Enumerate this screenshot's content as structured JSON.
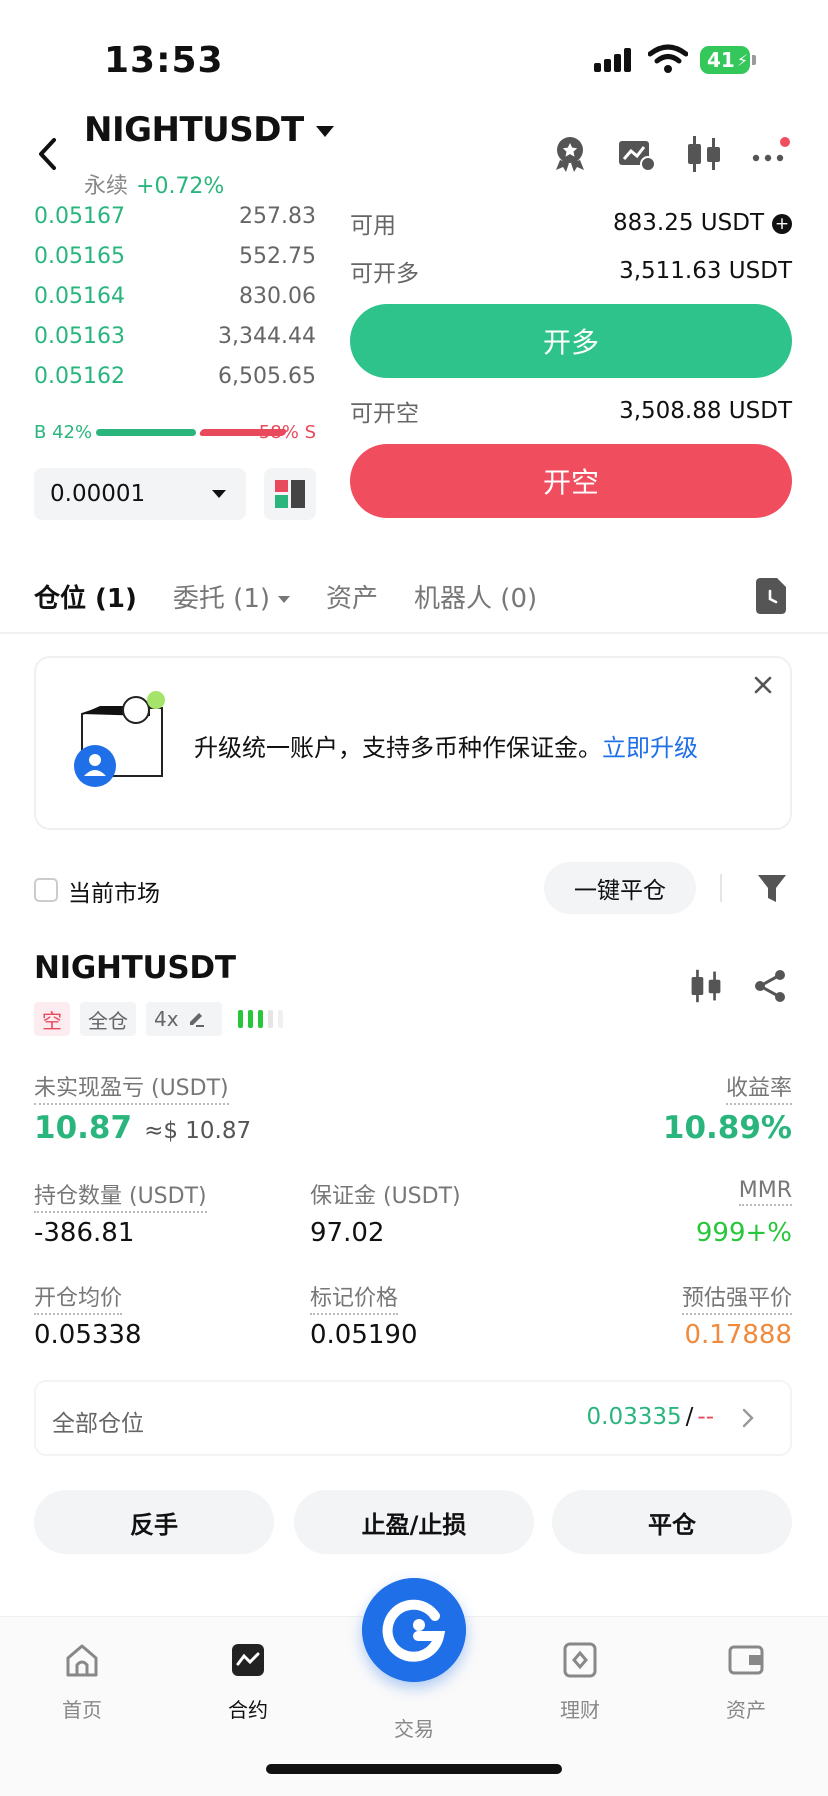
{
  "status_bar": {
    "time": "13:53",
    "battery": "41"
  },
  "header": {
    "title": "NIGHTUSDT",
    "sub_label": "永续",
    "change": "+0.72%"
  },
  "orderbook": {
    "bids": [
      {
        "price": "0.05167",
        "qty": "257.83",
        "depth": 0.04
      },
      {
        "price": "0.05165",
        "qty": "552.75",
        "depth": 0.08
      },
      {
        "price": "0.05164",
        "qty": "830.06",
        "depth": 0.13
      },
      {
        "price": "0.05163",
        "qty": "3,344.44",
        "depth": 0.51
      },
      {
        "price": "0.05162",
        "qty": "6,505.65",
        "depth": 1.0
      }
    ],
    "buy_ratio": "B 42%",
    "sell_ratio": "58% S",
    "precision": "0.00001"
  },
  "trade": {
    "available_label": "可用",
    "available_value": "883.25 USDT",
    "open_long_label": "可开多",
    "open_long_value": "3,511.63 USDT",
    "long_button": "开多",
    "open_short_label": "可开空",
    "open_short_value": "3,508.88 USDT",
    "short_button": "开空"
  },
  "tabs": {
    "positions": "仓位 (1)",
    "orders": "委托 (1)",
    "assets": "资产",
    "bots": "机器人 (0)"
  },
  "banner": {
    "text": "升级统一账户，支持多币种作保证金。",
    "link": "立即升级"
  },
  "filter": {
    "current_market": "当前市场",
    "close_all": "一键平仓"
  },
  "position": {
    "symbol": "NIGHTUSDT",
    "side_tag": "空",
    "margin_tag": "全仓",
    "leverage": "4x",
    "unrealized_label": "未实现盈亏 (USDT)",
    "unrealized_value": "10.87",
    "unrealized_approx": "≈$ 10.87",
    "roe_label": "收益率",
    "roe_value": "10.89%",
    "size_label": "持仓数量 (USDT)",
    "size_value": "-386.81",
    "margin_label": "保证金 (USDT)",
    "margin_value": "97.02",
    "mmr_label": "MMR",
    "mmr_value": "999+%",
    "entry_label": "开仓均价",
    "entry_value": "0.05338",
    "mark_label": "标记价格",
    "mark_value": "0.05190",
    "liq_label": "预估强平价",
    "liq_value": "0.17888",
    "all_positions_label": "全部仓位",
    "tpsl_tp": "0.03335",
    "tpsl_sep": "/",
    "tpsl_sl": "--",
    "reverse_button": "反手",
    "tpsl_button": "止盈/止损",
    "close_button": "平仓"
  },
  "nav": {
    "home": "首页",
    "contract": "合约",
    "trade": "交易",
    "earn": "理财",
    "assets": "资产"
  },
  "colors": {
    "green": "#2ab57d",
    "red": "#f04d5f",
    "blue": "#1f6fe8",
    "orange": "#f08a3c"
  }
}
